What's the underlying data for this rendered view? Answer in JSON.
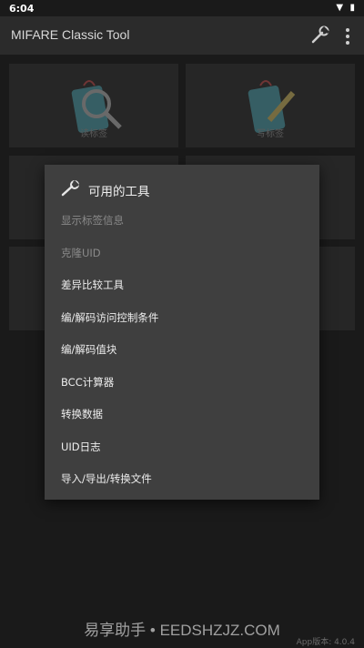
{
  "status": {
    "time": "6:04",
    "icons": "▼ ▮"
  },
  "appbar": {
    "title": "MIFARE Classic Tool"
  },
  "tiles": [
    {
      "label": "读标签"
    },
    {
      "label": "写标签"
    }
  ],
  "dialog": {
    "title": "可用的工具",
    "items": [
      {
        "label": "显示标签信息",
        "enabled": false
      },
      {
        "label": "克隆UID",
        "enabled": false
      },
      {
        "label": "差异比较工具",
        "enabled": true
      },
      {
        "label": "编/解码访问控制条件",
        "enabled": true
      },
      {
        "label": "编/解码值块",
        "enabled": true
      },
      {
        "label": "BCC计算器",
        "enabled": true
      },
      {
        "label": "转换数据",
        "enabled": true
      },
      {
        "label": "UID日志",
        "enabled": true
      },
      {
        "label": "导入/导出/转换文件",
        "enabled": true
      }
    ]
  },
  "footer": {
    "watermark": "易享助手 • EEDSHZJZ.COM",
    "version": "App版本: 4.0.4"
  }
}
